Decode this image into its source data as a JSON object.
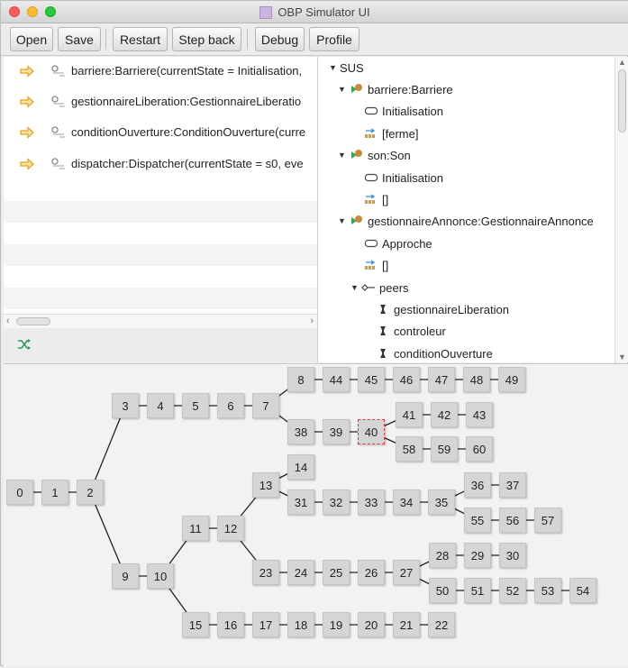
{
  "window": {
    "title": "OBP Simulator UI"
  },
  "toolbar": {
    "open_label": "Open",
    "save_label": "Save",
    "restart_label": "Restart",
    "stepback_label": "Step back",
    "debug_label": "Debug",
    "profile_label": "Profile"
  },
  "process_list": [
    "barriere:Barriere(currentState = Initialisation,",
    "gestionnaireLiberation:GestionnaireLiberatio",
    "conditionOuverture:ConditionOuverture(curre",
    "dispatcher:Dispatcher(currentState = s0, eve"
  ],
  "tree": {
    "root": "SUS",
    "barriere": "barriere:Barriere",
    "barriere_state": "Initialisation",
    "barriere_queue": "[ferme]",
    "son": "son:Son",
    "son_state": "Initialisation",
    "son_queue": "[]",
    "annonce": "gestionnaireAnnonce:GestionnaireAnnonce",
    "annonce_state": "Approche",
    "annonce_queue": "[]",
    "peers": "peers",
    "peer1": "gestionnaireLiberation",
    "peer2": "controleur",
    "peer3": "conditionOuverture"
  },
  "graph": {
    "selected": "40",
    "nodes": [
      "0",
      "1",
      "2",
      "3",
      "4",
      "5",
      "6",
      "7",
      "8",
      "44",
      "45",
      "46",
      "47",
      "48",
      "49",
      "38",
      "39",
      "40",
      "41",
      "42",
      "43",
      "58",
      "59",
      "60",
      "9",
      "10",
      "11",
      "12",
      "13",
      "14",
      "31",
      "32",
      "33",
      "34",
      "35",
      "36",
      "37",
      "55",
      "56",
      "57",
      "23",
      "24",
      "25",
      "26",
      "27",
      "28",
      "29",
      "30",
      "50",
      "51",
      "52",
      "53",
      "54",
      "15",
      "16",
      "17",
      "18",
      "19",
      "20",
      "21",
      "22"
    ]
  },
  "colors": {
    "selected_border": "#e23b3b",
    "node_fill": "#d5d5d5",
    "arrow_icon": "#f0b52b"
  }
}
